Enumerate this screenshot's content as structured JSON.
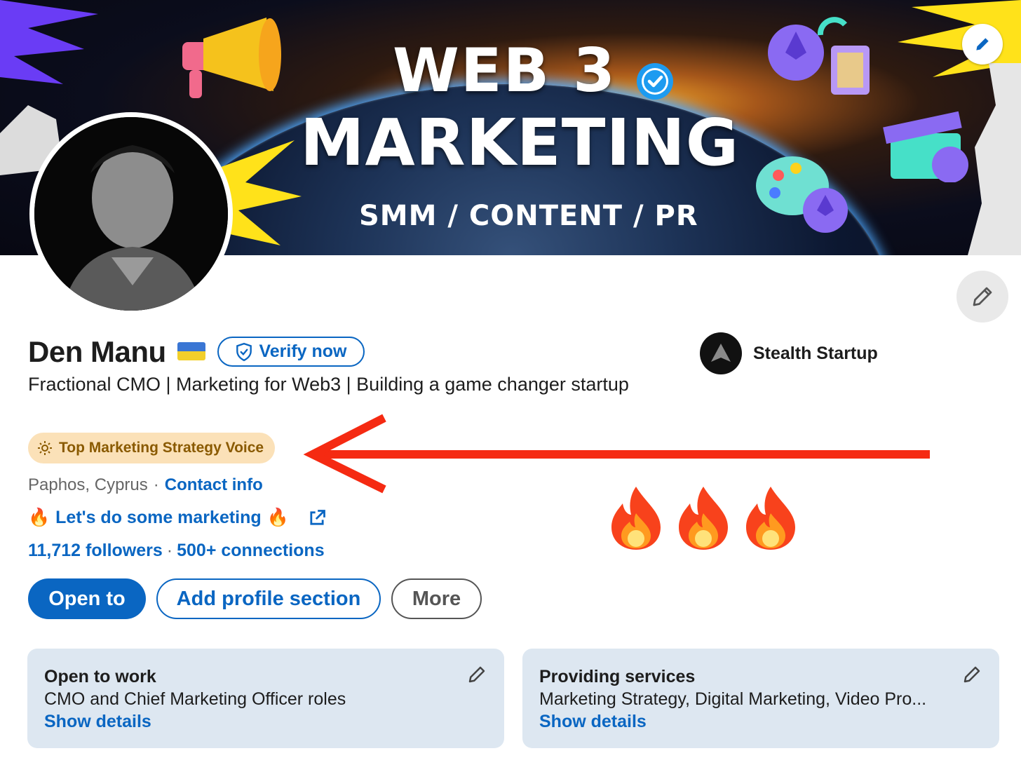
{
  "banner": {
    "title_line1": "WEB 3",
    "title_line2": "MARKETING",
    "subtitle": "SMM / CONTENT / PR",
    "edit_icon": "pencil-icon"
  },
  "profile": {
    "name": "Den Manu",
    "flag": "ukraine-flag",
    "verify_label": "Verify now",
    "headline": "Fractional CMO | Marketing for Web3 | Building a game changer startup",
    "voice_badge": "Top Marketing Strategy Voice",
    "location": "Paphos, Cyprus",
    "separator": "·",
    "contact_label": "Contact info",
    "link_label": "Let's do some marketing",
    "followers": "11,712 followers",
    "connections": "500+ connections"
  },
  "company": {
    "name": "Stealth Startup"
  },
  "actions": {
    "open_to": "Open to",
    "add_section": "Add profile section",
    "more": "More"
  },
  "cards": [
    {
      "title": "Open to work",
      "description": "CMO and Chief Marketing Officer roles",
      "link": "Show details"
    },
    {
      "title": "Providing services",
      "description": "Marketing Strategy, Digital Marketing, Video Pro...",
      "link": "Show details"
    }
  ],
  "colors": {
    "accent": "#0a66c2",
    "badge_bg": "#fbe1b8",
    "badge_text": "#8a5a00",
    "card_bg": "#dde7f1",
    "annotation_arrow": "#f52a12"
  }
}
